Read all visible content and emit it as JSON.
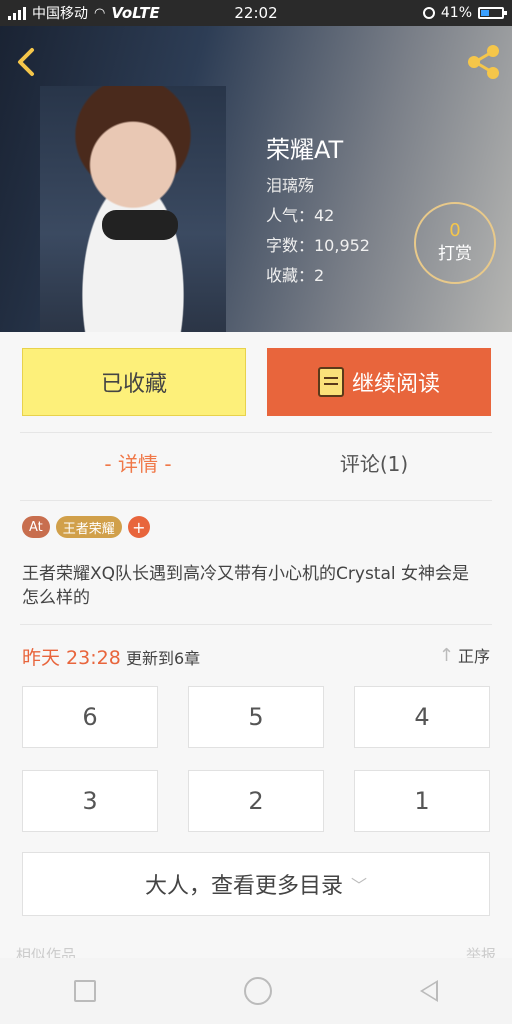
{
  "status_bar": {
    "carrier": "中国移动",
    "network": "VoLTE",
    "time": "22:02",
    "battery": "41%",
    "battery_level": 0.41
  },
  "header": {
    "back_icon": "chevron-left-icon",
    "share_icon": "share-icon",
    "accent_color": "#f5c64a"
  },
  "book": {
    "title": "荣耀AT",
    "author": "泪璃殇",
    "popularity": "人气：42",
    "word_count": "字数：10,952",
    "favorites": "收藏：2",
    "reward_count": "0",
    "reward_label": "打赏"
  },
  "actions": {
    "favorited_label": "已收藏",
    "continue_label": "继续阅读",
    "continue_icon": "book-icon"
  },
  "tabs": {
    "detail": "- 详情 -",
    "comments": "评论(1)"
  },
  "tags": [
    "At",
    "王者荣耀"
  ],
  "add_tag": "+",
  "description": "王者荣耀XQ队长遇到高冷又带有小心机的Crystal 女神会是怎么样的",
  "update": {
    "time": "昨天 23:28",
    "text": "更新到6章",
    "sort_label": "正序",
    "sort_icon": "arrow-up-icon"
  },
  "chapters": [
    "6",
    "5",
    "4",
    "3",
    "2",
    "1"
  ],
  "more": {
    "label": "大人，查看更多目录",
    "chevron_icon": "chevron-down-icon"
  },
  "peek": {
    "left": "相似作品",
    "right": "举报"
  },
  "colors": {
    "primary": "#e8653c",
    "favorite_bg": "#fdf07a"
  }
}
